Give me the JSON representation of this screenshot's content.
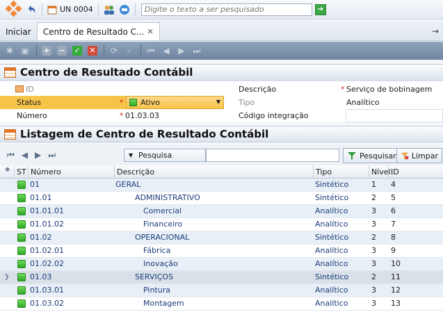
{
  "toolbar": {
    "unit_label": "UN 0004",
    "search_placeholder": "Digite o texto a ser pesquisado"
  },
  "tabs": [
    {
      "label": "Iniciar",
      "active": false
    },
    {
      "label": "Centro de Resultado C...",
      "active": true
    }
  ],
  "form": {
    "title": "Centro de Resultado Contábil",
    "id_label": "ID",
    "status_label": "Status",
    "status_value": "Ativo",
    "numero_label": "Número",
    "numero_value": "01.03.03",
    "descricao_label": "Descrição",
    "descricao_value": "Serviço de bobinagem",
    "tipo_label": "Tipo",
    "tipo_value": "Analítico",
    "codigo_label": "Código integração",
    "codigo_value": ""
  },
  "listing": {
    "title": "Listagem de Centro de Resultado Contábil",
    "search_dropdown": "Pesquisa",
    "pesquisar_label": "Pesquisar",
    "limpar_label": "Limpar",
    "columns": [
      "ST",
      "Número",
      "Descrição",
      "Tipo",
      "Nível",
      "ID"
    ],
    "rows": [
      {
        "numero": "01",
        "descricao": "GERAL",
        "tipo": "Sintético",
        "nivel": "1",
        "id": "4"
      },
      {
        "numero": "01.01",
        "descricao": "ADMINISTRATIVO",
        "tipo": "Sintético",
        "nivel": "2",
        "id": "5"
      },
      {
        "numero": "01.01.01",
        "descricao": "Comercial",
        "tipo": "Analítico",
        "nivel": "3",
        "id": "6"
      },
      {
        "numero": "01.01.02",
        "descricao": "Financeiro",
        "tipo": "Analítico",
        "nivel": "3",
        "id": "7"
      },
      {
        "numero": "01.02",
        "descricao": "OPERACIONAL",
        "tipo": "Sintético",
        "nivel": "2",
        "id": "8"
      },
      {
        "numero": "01.02.01",
        "descricao": "Fábrica",
        "tipo": "Analítico",
        "nivel": "3",
        "id": "9"
      },
      {
        "numero": "01.02.02",
        "descricao": "Inovação",
        "tipo": "Analítico",
        "nivel": "3",
        "id": "10"
      },
      {
        "numero": "01.03",
        "descricao": "SERVIÇOS",
        "tipo": "Sintético",
        "nivel": "2",
        "id": "11"
      },
      {
        "numero": "01.03.01",
        "descricao": "Pintura",
        "tipo": "Analítico",
        "nivel": "3",
        "id": "12"
      },
      {
        "numero": "01.03.02",
        "descricao": "Montagem",
        "tipo": "Analítico",
        "nivel": "3",
        "id": "13"
      }
    ]
  },
  "colors": {
    "status_active": "#2ea827",
    "status_highlight": "#f7c44a",
    "toolbar_bg": "#7d92ad"
  }
}
